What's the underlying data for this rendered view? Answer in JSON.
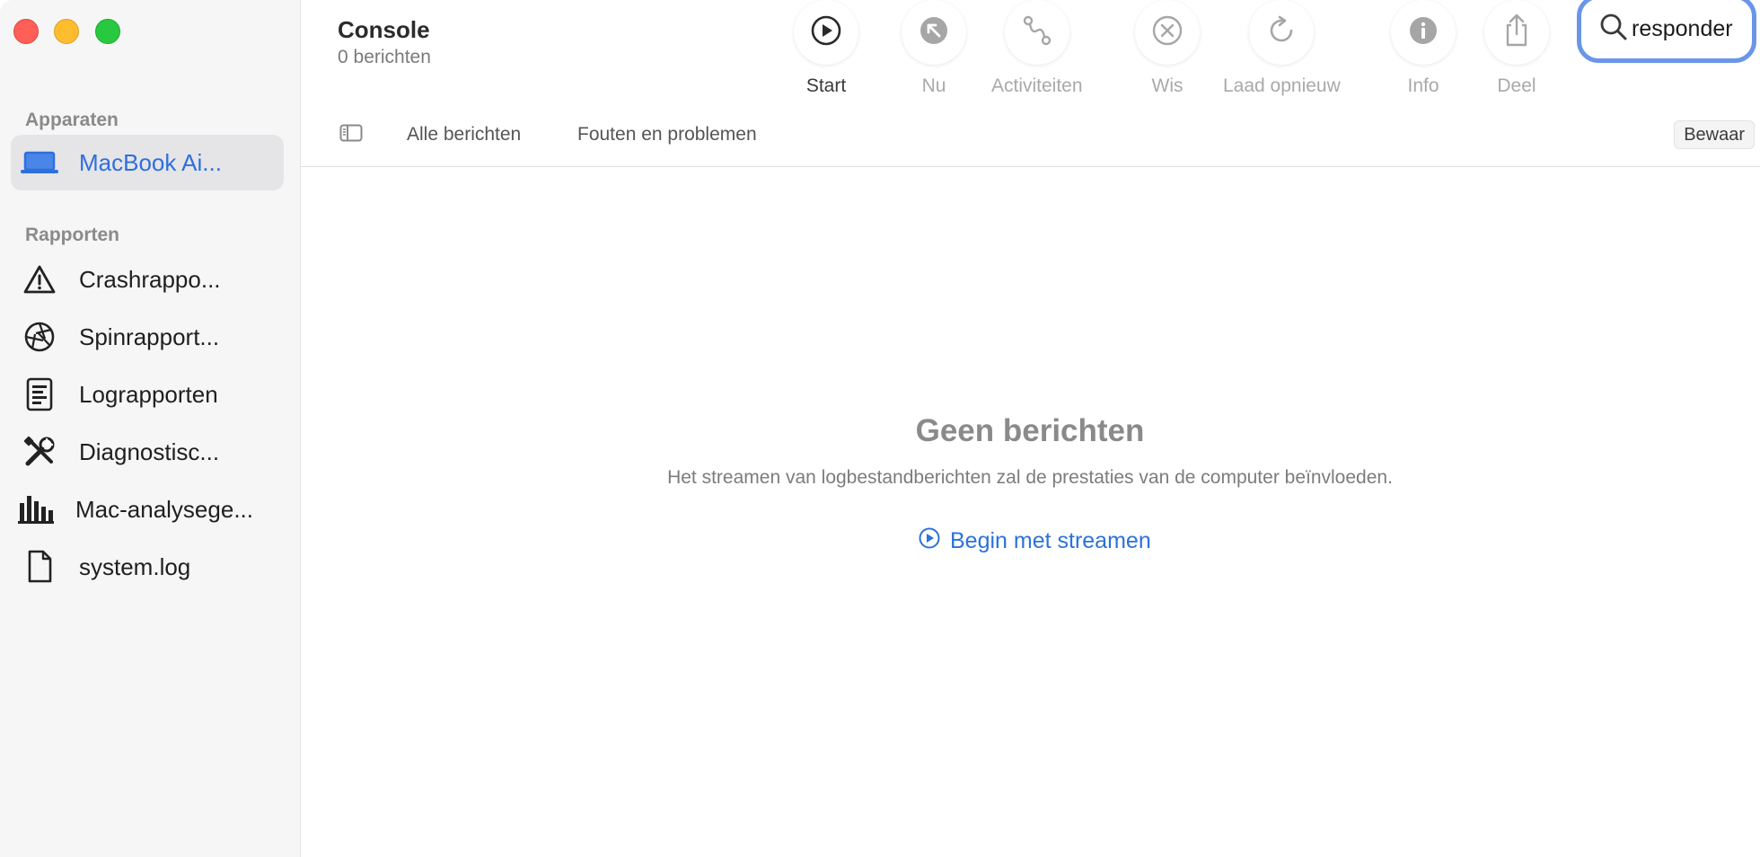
{
  "window": {
    "title": "Console",
    "subtitle": "0 berichten"
  },
  "toolbar": {
    "start": "Start",
    "nu": "Nu",
    "activiteiten": "Activiteiten",
    "wis": "Wis",
    "laad_opnieuw": "Laad opnieuw",
    "info": "Info",
    "deel": "Deel"
  },
  "search": {
    "value": "responder"
  },
  "sidebar": {
    "devices_header": "Apparaten",
    "devices": [
      {
        "label": "MacBook Ai...",
        "icon": "laptop-icon"
      }
    ],
    "reports_header": "Rapporten",
    "reports": [
      {
        "label": "Crashrappo...",
        "icon": "warning-triangle-icon"
      },
      {
        "label": "Spinrapport...",
        "icon": "aperture-icon"
      },
      {
        "label": "Lograpporten",
        "icon": "document-lines-icon"
      },
      {
        "label": "Diagnostisc...",
        "icon": "tools-icon"
      },
      {
        "label": "Mac-analysege...",
        "icon": "bar-chart-icon"
      },
      {
        "label": "system.log",
        "icon": "file-icon"
      }
    ]
  },
  "filters": {
    "all": "Alle berichten",
    "errors": "Fouten en problemen",
    "save": "Bewaar"
  },
  "empty_state": {
    "title": "Geen berichten",
    "description": "Het streamen van logbestandberichten zal de prestaties van de computer beïnvloeden.",
    "action": "Begin met streamen"
  },
  "colors": {
    "accent": "#2b72db",
    "close": "#ff5f57",
    "minimize": "#febc2e",
    "maximize": "#28c840"
  }
}
